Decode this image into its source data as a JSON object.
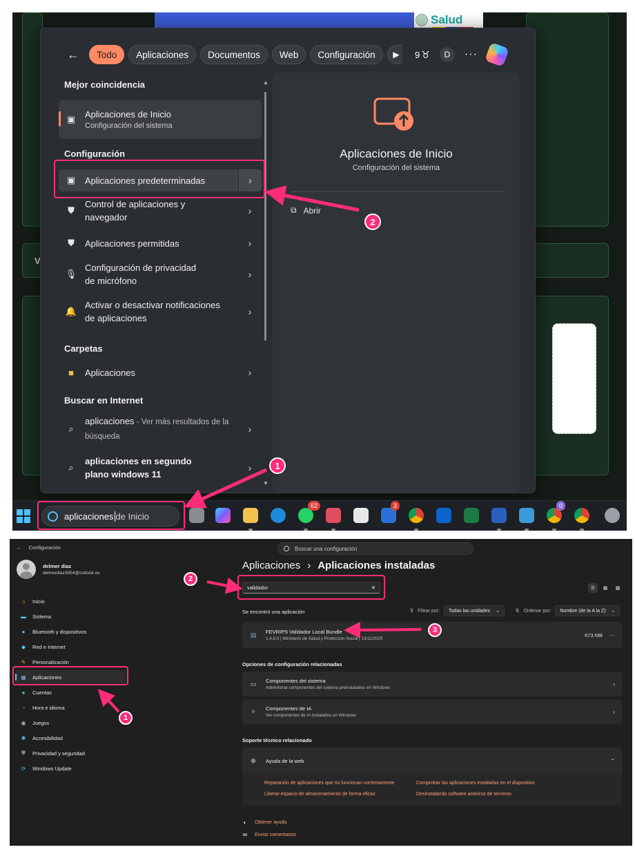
{
  "top": {
    "brand_text": "Salud",
    "filters": {
      "chips": [
        "Todo",
        "Aplicaciones",
        "Documentos",
        "Web",
        "Configuración"
      ],
      "points": "9",
      "user_initial": "D",
      "more": "···"
    },
    "results": {
      "best_heading": "Mejor coincidencia",
      "best": {
        "title": "Aplicaciones de Inicio",
        "subtitle": "Configuración del sistema"
      },
      "config_heading": "Configuración",
      "config_items": [
        "Aplicaciones predeterminadas",
        "Control de aplicaciones y navegador",
        "Aplicaciones permitidas",
        "Configuración de privacidad de micrófono",
        "Activar o desactivar notificaciones de aplicaciones"
      ],
      "folders_heading": "Carpetas",
      "folder_item": "Aplicaciones",
      "web_heading": "Buscar en Internet",
      "web_items": [
        {
          "bold": "aplicaciones",
          "rest": " - Ver más resultados de la búsqueda"
        },
        {
          "bold": "aplicaciones en segundo plano windows 11",
          "rest": ""
        }
      ]
    },
    "preview": {
      "title": "Aplicaciones de Inicio",
      "subtitle": "Configuración del sistema",
      "open_label": "Abrir"
    },
    "taskbar": {
      "search_typed": "aplicaciones",
      "search_ghost": "de Inicio",
      "badges": {
        "whatsapp": "62",
        "l_app": "3",
        "chrome_profile": "0"
      }
    },
    "bg_letter": "V"
  },
  "bottom": {
    "window_title": "Configuración",
    "search_placeholder": "Buscar una configuración",
    "profile": {
      "name": "delmer diaz",
      "email": "delmerdiaz3954@outlook.es"
    },
    "nav": [
      {
        "label": "Inicio",
        "icon": "home-icon"
      },
      {
        "label": "Sistema",
        "icon": "system-icon"
      },
      {
        "label": "Bluetooth y dispositivos",
        "icon": "bluetooth-icon"
      },
      {
        "label": "Red e Internet",
        "icon": "wifi-icon"
      },
      {
        "label": "Personalización",
        "icon": "brush-icon"
      },
      {
        "label": "Aplicaciones",
        "icon": "apps-icon"
      },
      {
        "label": "Cuentas",
        "icon": "account-icon"
      },
      {
        "label": "Hora e idioma",
        "icon": "clock-icon"
      },
      {
        "label": "Juegos",
        "icon": "gamepad-icon"
      },
      {
        "label": "Accesibilidad",
        "icon": "accessibility-icon"
      },
      {
        "label": "Privacidad y seguridad",
        "icon": "shield-icon"
      },
      {
        "label": "Windows Update",
        "icon": "update-icon"
      }
    ],
    "breadcrumb": {
      "parent": "Aplicaciones",
      "separator": "›",
      "current": "Aplicaciones instaladas"
    },
    "filter_value": "validador",
    "found_text": "Se encontró una aplicación",
    "filter_by_label": "Filtrar por:",
    "filter_by_value": "Todas las unidades",
    "sort_label": "Ordenar por:",
    "sort_value": "Nombre (de la A la Z)",
    "app": {
      "name": "FEVRIPS Validador Local Bundle",
      "details": "1.4.6.0  |  Ministerio de Salud y Protección Social  |  13/11/2025",
      "size": "673 MB",
      "more": "···"
    },
    "related_heading": "Opciones de configuración relacionadas",
    "related": [
      {
        "title": "Componentes del sistema",
        "subtitle": "Administrar componentes del sistema preinstalados en Windows"
      },
      {
        "title": "Componentes de IA",
        "subtitle": "Ver componentes de IA instalados en Windows"
      }
    ],
    "support_heading": "Soporte técnico relacionado",
    "web_help": {
      "title": "Ayuda de la web",
      "links": [
        "Reparación de aplicaciones que no funcionan correctamente",
        "Comprobar las aplicaciones instaladas en el dispositivo",
        "Liberar espacio de almacenamiento de forma eficaz",
        "Desinstalando software antivirus de terceros"
      ]
    },
    "footer": {
      "help": "Obtener ayuda",
      "feedback": "Enviar comentarios"
    }
  },
  "annotations": {
    "top_steps": [
      "1",
      "2"
    ],
    "bottom_steps": [
      "2",
      "1",
      "3"
    ],
    "color": "#ff2c79"
  }
}
